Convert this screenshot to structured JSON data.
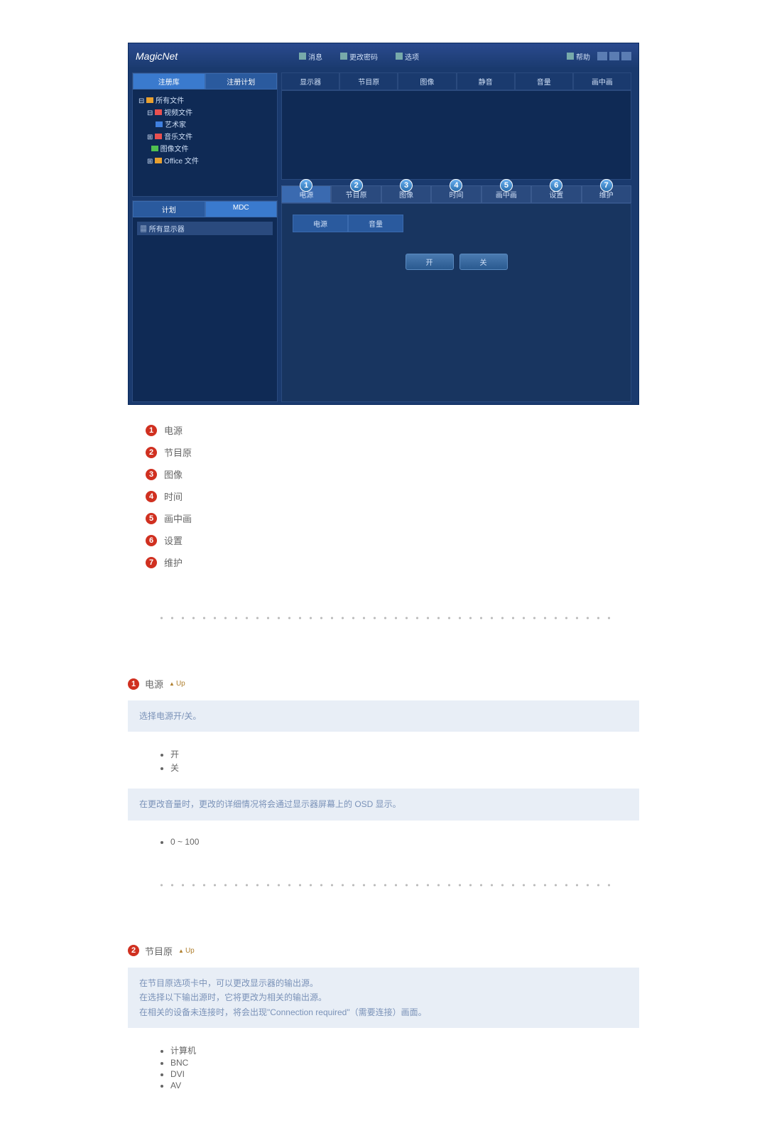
{
  "screenshot": {
    "logo": "MagicNet",
    "header_buttons": [
      "消息",
      "更改密码",
      "选项"
    ],
    "header_right": "帮助",
    "left_tabs": [
      "注册库",
      "注册计划"
    ],
    "tree": [
      "所有文件",
      "视频文件",
      "艺术家",
      "音乐文件",
      "图像文件",
      "Office 文件"
    ],
    "bottom_tabs": [
      "计划",
      "MDC"
    ],
    "monitor_item": "所有显示器",
    "columns": [
      "显示器",
      "节目原",
      "图像",
      "静音",
      "音量",
      "画中画"
    ],
    "nav_tabs": [
      "电源",
      "节目原",
      "图像",
      "时间",
      "画中画",
      "设置",
      "维护"
    ],
    "sub_tabs": [
      "电源",
      "音量"
    ],
    "toggle": [
      "开",
      "关"
    ]
  },
  "legend": [
    "电源",
    "节目原",
    "图像",
    "时间",
    "画中画",
    "设置",
    "维护"
  ],
  "section1": {
    "title": "电源",
    "up": "Up",
    "box1": "选择电源开/关。",
    "bullets1": [
      "开",
      "关"
    ],
    "box2": "在更改音量时，更改的详细情况将会通过显示器屏幕上的 OSD 显示。",
    "bullets2": [
      "0 ~ 100"
    ]
  },
  "section2": {
    "title": "节目原",
    "up": "Up",
    "box_lines": [
      "在节目原选项卡中，可以更改显示器的输出源。",
      "在选择以下输出源时，它将更改为相关的输出源。",
      "在相关的设备未连接时，将会出现\"Connection required\"（需要连接）画面。"
    ],
    "bullets": [
      "计算机",
      "BNC",
      "DVI",
      "AV"
    ]
  }
}
